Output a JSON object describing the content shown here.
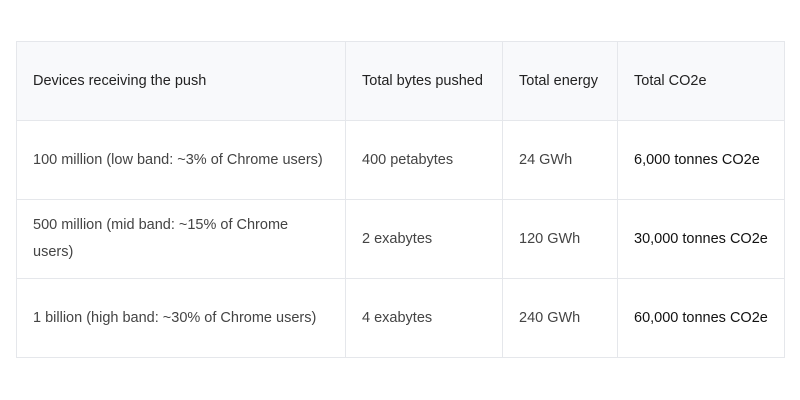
{
  "table": {
    "headers": [
      "Devices receiving the push",
      "Total bytes pushed",
      "Total energy",
      "Total CO2e"
    ],
    "rows": [
      [
        "100 million (low band: ~3% of Chrome users)",
        "400 petabytes",
        "24 GWh",
        "6,000 tonnes CO2e"
      ],
      [
        "500 million (mid band: ~15% of Chrome users)",
        "2 exabytes",
        "120 GWh",
        "30,000 tonnes CO2e"
      ],
      [
        "1 billion (high band: ~30% of Chrome users)",
        "4 exabytes",
        "240 GWh",
        "60,000 tonnes CO2e"
      ]
    ]
  }
}
